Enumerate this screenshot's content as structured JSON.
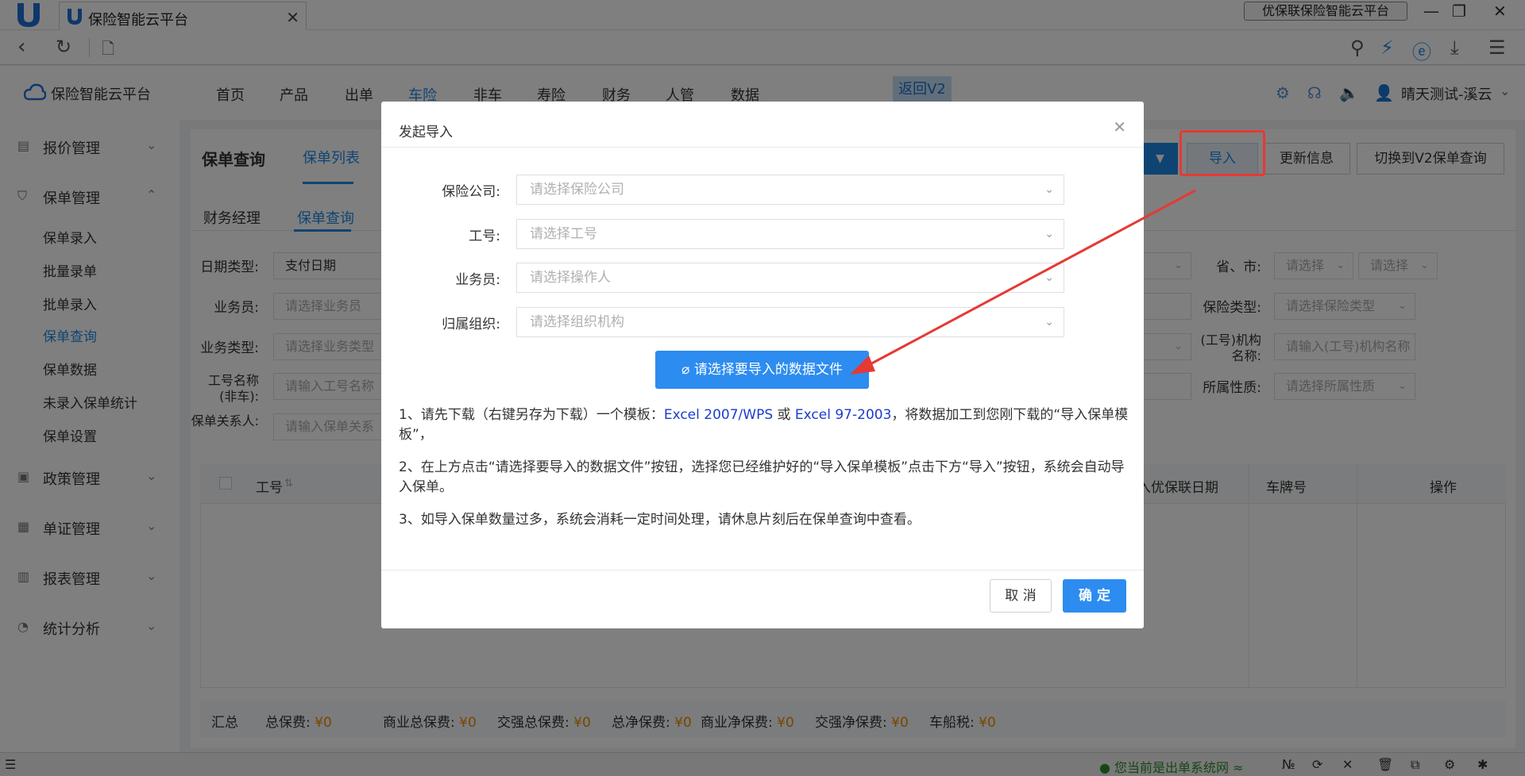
{
  "browser": {
    "tab_title": "保险智能云平台",
    "window_label": "优保联保险智能云平台"
  },
  "app": {
    "logo_text": "保险智能云平台",
    "nav": [
      "首页",
      "产品",
      "出单",
      "车险",
      "非车",
      "寿险",
      "财务",
      "人管",
      "数据"
    ],
    "v2_button": "返回V2",
    "user_name": "晴天测试-溪云"
  },
  "sidebar": {
    "groups": [
      {
        "label": "报价管理"
      },
      {
        "label": "保单管理"
      },
      {
        "label": "政策管理"
      },
      {
        "label": "单证管理"
      },
      {
        "label": "报表管理"
      },
      {
        "label": "统计分析"
      }
    ],
    "items": [
      "保单录入",
      "批量录单",
      "批单录入",
      "保单查询",
      "保单数据",
      "未录入保单统计",
      "保单设置"
    ]
  },
  "main": {
    "title": "保单查询",
    "subtab": "保单列表",
    "buttons": {
      "import": "导入",
      "update": "更新信息",
      "switch_v2": "切换到V2保单查询"
    },
    "tabs": [
      "财务经理",
      "保单查询"
    ],
    "filters": {
      "date_type_label": "日期类型:",
      "date_type_value": "支付日期",
      "salesman_label": "业务员:",
      "salesman_ph": "请选择业务员",
      "biztype_label": "业务类型:",
      "biztype_ph": "请选择业务类型",
      "workname_label": "工号名称(非车):",
      "workname_ph": "请输入工号名称",
      "relation_label": "保单关系人:",
      "relation_ph": "请输入保单关系",
      "province_label": "省、市:",
      "province_ph1": "请选择",
      "province_ph2": "请选择",
      "instype_label": "保险类型:",
      "instype_ph": "请选择保险类型",
      "org_label": "(工号)机构名称:",
      "org_ph": "请输入(工号)机构名称",
      "nature_label": "所属性质:",
      "nature_ph": "请选择所属性质"
    },
    "table": {
      "col_work": "工号",
      "col_date": "入优保联日期",
      "col_plate": "车牌号",
      "col_op": "操作"
    },
    "summary": {
      "label": "汇总",
      "items": [
        {
          "name": "总保费:",
          "value": "¥0"
        },
        {
          "name": "商业总保费:",
          "value": "¥0"
        },
        {
          "name": "交强总保费:",
          "value": "¥0"
        },
        {
          "name": "总净保费:",
          "value": "¥0"
        },
        {
          "name": "商业净保费:",
          "value": "¥0"
        },
        {
          "name": "交强净保费:",
          "value": "¥0"
        },
        {
          "name": "车船税:",
          "value": "¥0"
        }
      ]
    }
  },
  "modal": {
    "title": "发起导入",
    "fields": [
      {
        "label": "保险公司:",
        "placeholder": "请选择保险公司"
      },
      {
        "label": "工号:",
        "placeholder": "请选择工号"
      },
      {
        "label": "业务员:",
        "placeholder": "请选择操作人"
      },
      {
        "label": "归属组织:",
        "placeholder": "请选择组织机构"
      }
    ],
    "upload_label": "请选择要导入的数据文件",
    "instr1_pre": "1、请先下载（右键另存为下载）一个模板：",
    "instr1_link1": "Excel 2007/WPS",
    "instr1_mid": " 或 ",
    "instr1_link2": "Excel 97-2003",
    "instr1_post": "，将数据加工到您刚下载的“导入保单模板”，",
    "instr2": "2、在上方点击“请选择要导入的数据文件”按钮，选择您已经维护好的“导入保单模板”点击下方“导入”按钮，系统会自动导入保单。",
    "instr3": "3、如导入保单数量过多，系统会消耗一定时间处理，请休息片刻后在保单查询中查看。",
    "cancel": "取 消",
    "ok": "确 定"
  },
  "status": {
    "text": "您当前是出单系统网"
  },
  "colors": {
    "accent": "#2d8cf0",
    "highlight": "#e53935",
    "money": "#f08c00"
  }
}
